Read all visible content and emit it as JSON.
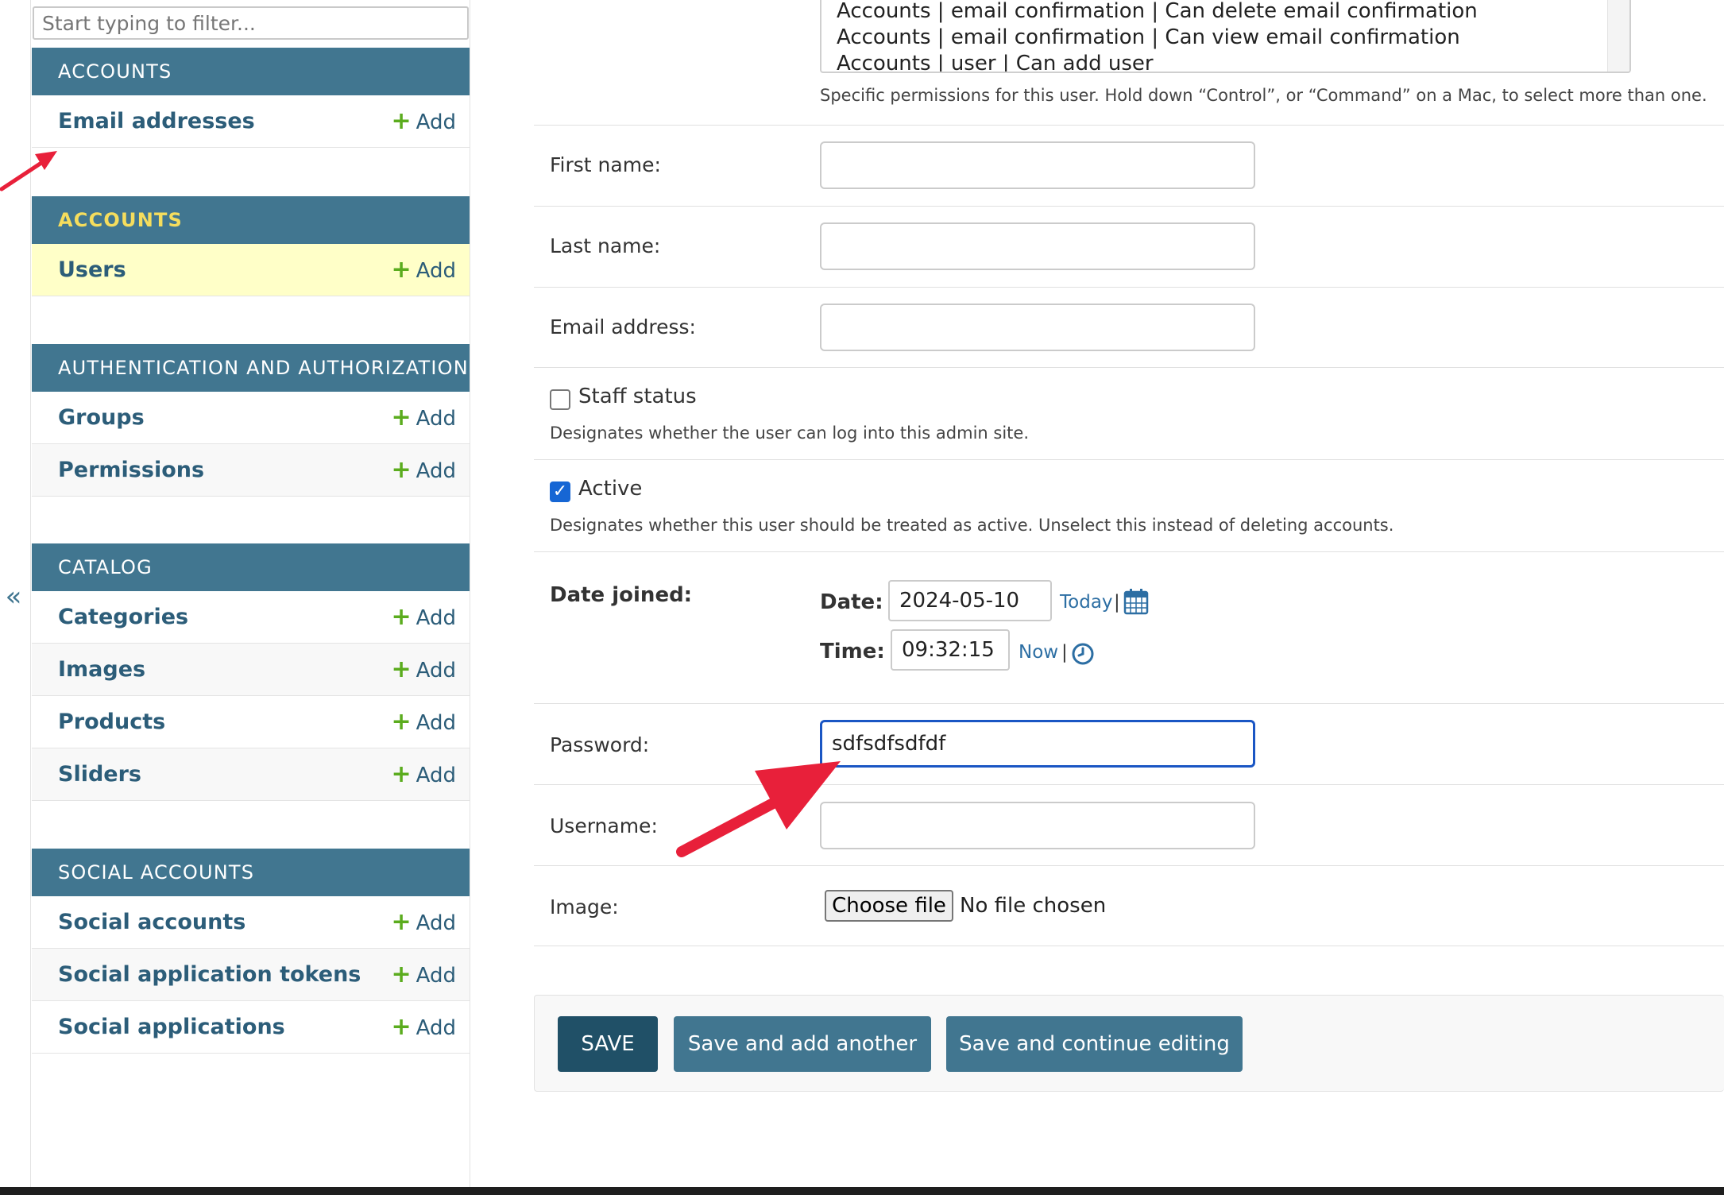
{
  "sidebar": {
    "collapse_glyph": "«",
    "filter_placeholder": "Start typing to filter...",
    "add_label": "Add",
    "modules": [
      {
        "caption": "ACCOUNTS",
        "current": false,
        "models": [
          "Email addresses"
        ]
      },
      {
        "caption": "ACCOUNTS",
        "current": true,
        "models": [
          "Users"
        ]
      },
      {
        "caption": "AUTHENTICATION AND AUTHORIZATION",
        "current": false,
        "models": [
          "Groups",
          "Permissions"
        ]
      },
      {
        "caption": "CATALOG",
        "current": false,
        "models": [
          "Categories",
          "Images",
          "Products",
          "Sliders"
        ]
      },
      {
        "caption": "SOCIAL ACCOUNTS",
        "current": false,
        "models": [
          "Social accounts",
          "Social application tokens",
          "Social applications"
        ]
      }
    ],
    "selected_model": "Users"
  },
  "form": {
    "permission_options": [
      "Accounts | email confirmation | Can delete email confirmation",
      "Accounts | email confirmation | Can view email confirmation",
      "Accounts | user | Can add user"
    ],
    "permissions_help": "Specific permissions for this user. Hold down “Control”, or “Command” on a Mac, to select more than one.",
    "first_name": {
      "label": "First name:",
      "value": ""
    },
    "last_name": {
      "label": "Last name:",
      "value": ""
    },
    "email": {
      "label": "Email address:",
      "value": ""
    },
    "staff_status": {
      "label": "Staff status",
      "checked": false,
      "help": "Designates whether the user can log into this admin site."
    },
    "active": {
      "label": "Active",
      "checked": true,
      "help": "Designates whether this user should be treated as active. Unselect this instead of deleting accounts."
    },
    "date_joined": {
      "label": "Date joined:",
      "date_label": "Date:",
      "date_value": "2024-05-10",
      "today_label": "Today",
      "time_label": "Time:",
      "time_value": "09:32:15",
      "now_label": "Now",
      "separator": "|"
    },
    "password": {
      "label": "Password:",
      "value": "sdfsdfsdfdf"
    },
    "username": {
      "label": "Username:",
      "value": ""
    },
    "image": {
      "label": "Image:",
      "button_label": "Choose file",
      "status": "No file chosen"
    }
  },
  "actions": {
    "save": "SAVE",
    "save_add_another": "Save and add another",
    "save_continue": "Save and continue editing"
  },
  "colors": {
    "module_header": "#417690",
    "model_link": "#2c5d79",
    "add_icon": "#5bac1e",
    "selected_row": "#ffffc8",
    "annotation_arrow": "#e8203a",
    "focus_border": "#1a56c4"
  }
}
